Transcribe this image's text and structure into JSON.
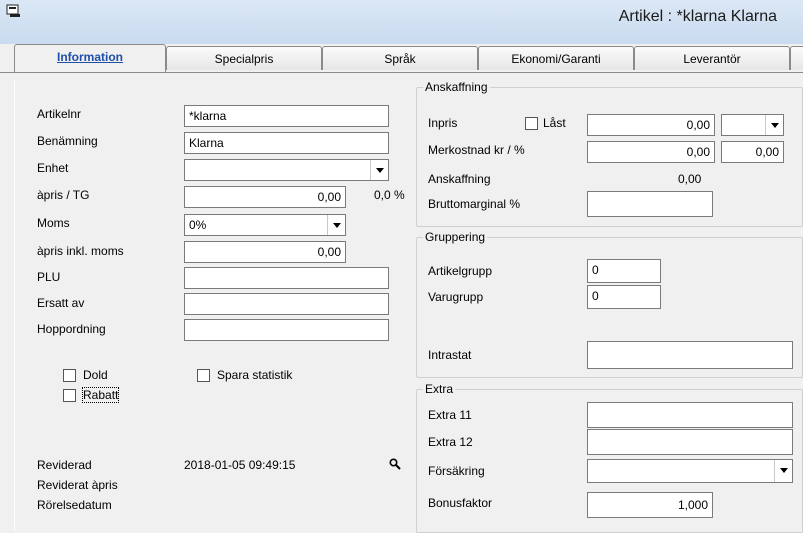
{
  "window": {
    "title": "Artikel : *klarna Klarna"
  },
  "tabs": [
    {
      "label": "Information"
    },
    {
      "label": "Specialpris"
    },
    {
      "label": "Språk"
    },
    {
      "label": "Ekonomi/Garanti"
    },
    {
      "label": "Leverantör"
    }
  ],
  "left": {
    "artikelnr_label": "Artikelnr",
    "artikelnr_value": "*klarna",
    "benamning_label": "Benämning",
    "benamning_value": "Klarna",
    "enhet_label": "Enhet",
    "enhet_value": "",
    "apris_label": "àpris / TG",
    "apris_value": "0,00",
    "tg_percent": "0,0 %",
    "moms_label": "Moms",
    "moms_value": "0%",
    "apris_inkl_label": "àpris inkl. moms",
    "apris_inkl_value": "0,00",
    "plu_label": "PLU",
    "plu_value": "",
    "ersatt_label": "Ersatt av",
    "ersatt_value": "",
    "hopp_label": "Hoppordning",
    "hopp_value": "",
    "dold_label": "Dold",
    "rabatt_label": "Rabatt",
    "spara_label": "Spara statistik",
    "reviderad_label": "Reviderad",
    "reviderad_value": "2018-01-05 09:49:15",
    "reviderat_apris_label": "Reviderat àpris",
    "rorelsedatum_label": "Rörelsedatum"
  },
  "anskaffning": {
    "legend": "Anskaffning",
    "inpris_label": "Inpris",
    "last_label": "Låst",
    "inpris_value": "0,00",
    "currency_value": "",
    "merkostnad_label": "Merkostnad kr / %",
    "merkostnad_kr": "0,00",
    "merkostnad_pct": "0,00",
    "anskaffning_label": "Anskaffning",
    "anskaffning_value": "0,00",
    "brutto_label": "Bruttomarginal %",
    "brutto_value": ""
  },
  "gruppering": {
    "legend": "Gruppering",
    "artikelgrupp_label": "Artikelgrupp",
    "artikelgrupp_value": "0",
    "varugrupp_label": "Varugrupp",
    "varugrupp_value": "0",
    "intrastat_label": "Intrastat",
    "intrastat_value": ""
  },
  "extra": {
    "legend": "Extra",
    "extra11_label": "Extra 11",
    "extra11_value": "",
    "extra12_label": "Extra 12",
    "extra12_value": "",
    "forsakring_label": "Försäkring",
    "forsakring_value": "",
    "bonus_label": "Bonusfaktor",
    "bonus_value": "1,000"
  }
}
